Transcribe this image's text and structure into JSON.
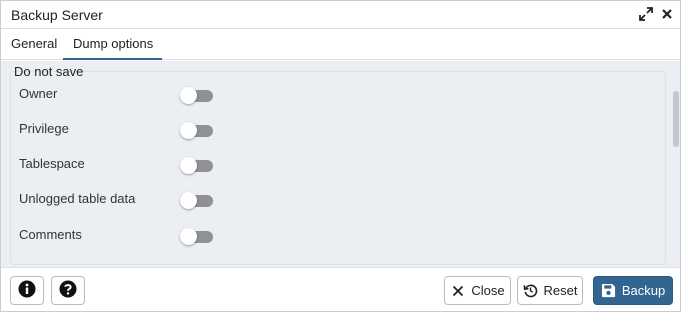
{
  "window": {
    "title": "Backup Server"
  },
  "tabs": [
    {
      "label": "General",
      "active": false
    },
    {
      "label": "Dump options",
      "active": true
    }
  ],
  "section": {
    "legend": "Do not save",
    "options": [
      {
        "label": "Owner",
        "on": false
      },
      {
        "label": "Privilege",
        "on": false
      },
      {
        "label": "Tablespace",
        "on": false
      },
      {
        "label": "Unlogged table data",
        "on": false
      },
      {
        "label": "Comments",
        "on": false
      }
    ]
  },
  "footer": {
    "close_label": "Close",
    "reset_label": "Reset",
    "backup_label": "Backup"
  },
  "icons": {
    "expand": "expand-icon",
    "close": "close-icon",
    "info": "info-icon",
    "help": "help-icon",
    "reset": "reset-icon",
    "save": "save-icon"
  },
  "colors": {
    "primary": "#326690",
    "content_bg": "#ebeef3",
    "toggle_off": "#8f9197"
  }
}
